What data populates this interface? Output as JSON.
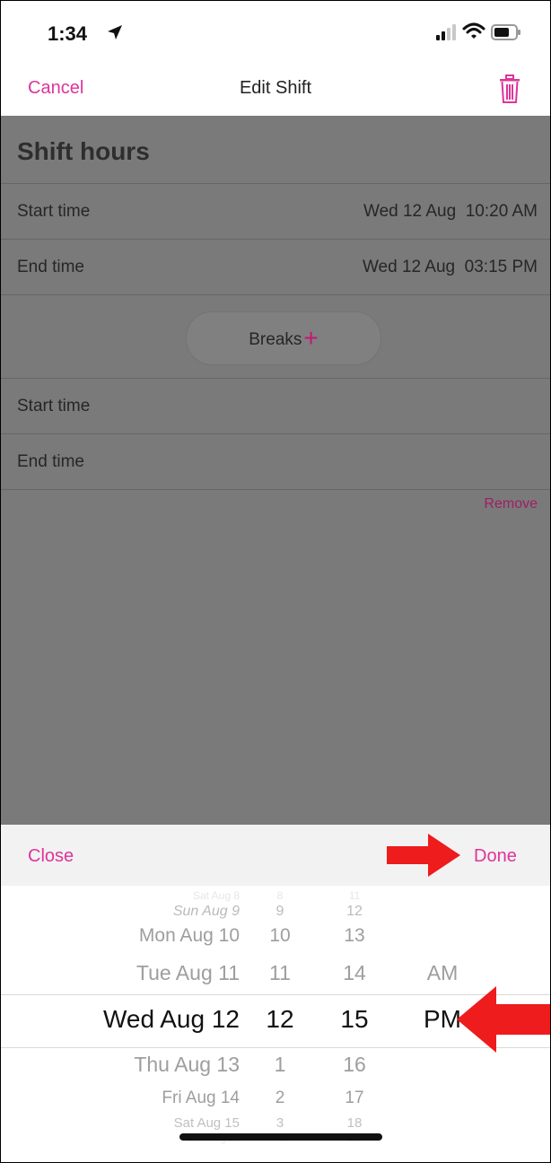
{
  "status_bar": {
    "time": "1:34"
  },
  "nav": {
    "cancel": "Cancel",
    "title": "Edit Shift"
  },
  "shift": {
    "section_title": "Shift hours",
    "start": {
      "label": "Start time",
      "value": "Wed 12 Aug  10:20 AM"
    },
    "end": {
      "label": "End time",
      "value": "Wed 12 Aug  03:15 PM"
    }
  },
  "breaks": {
    "button_label": "Breaks",
    "start_label": "Start time",
    "end_label": "End time",
    "remove_label": "Remove"
  },
  "picker_toolbar": {
    "close": "Close",
    "done": "Done"
  },
  "picker": {
    "dates": [
      "Sat Aug 8",
      "Sun Aug 9",
      "Mon Aug 10",
      "Tue Aug 11",
      "Wed Aug 12",
      "Thu Aug 13",
      "Fri Aug 14",
      "Sat Aug 15",
      "Sun Aug 16"
    ],
    "hours": [
      "8",
      "9",
      "10",
      "11",
      "12",
      "1",
      "2",
      "3",
      "4"
    ],
    "minutes": [
      "11",
      "12",
      "13",
      "14",
      "15",
      "16",
      "17",
      "18",
      "19"
    ],
    "ampm": [
      "AM",
      "PM"
    ],
    "selected": {
      "date": "Wed Aug 12",
      "hour": "12",
      "minute": "15",
      "ampm": "PM"
    }
  },
  "colors": {
    "accent": "#e0339a",
    "dim_overlay": "#7a7a7a",
    "annotation_arrow": "#ee1c1c"
  },
  "icons": [
    "location-arrow-icon",
    "signal-icon",
    "wifi-icon",
    "battery-icon",
    "trash-icon",
    "plus-icon"
  ]
}
